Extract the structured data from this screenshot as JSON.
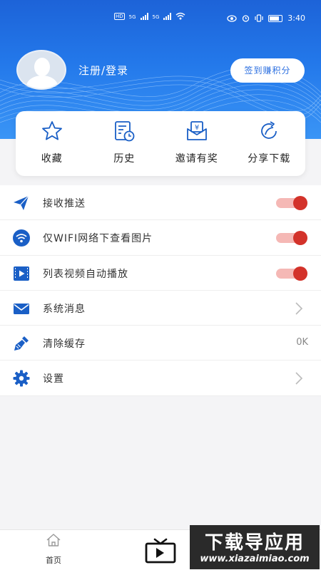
{
  "status_bar": {
    "time": "3:40",
    "left_badges": [
      "HD",
      "HD"
    ],
    "network_labels": [
      "5G",
      "5G"
    ],
    "battery_level": 0.7
  },
  "profile": {
    "login_label": "注册/登录",
    "checkin_button": "签到赚积分"
  },
  "quick_actions": [
    {
      "label": "收藏",
      "icon": "star-icon"
    },
    {
      "label": "历史",
      "icon": "history-icon"
    },
    {
      "label": "邀请有奖",
      "icon": "invite-reward-icon"
    },
    {
      "label": "分享下载",
      "icon": "share-icon"
    }
  ],
  "settings": [
    {
      "label": "接收推送",
      "icon": "send-icon",
      "control": "toggle",
      "on": true
    },
    {
      "label": "仅WIFI网络下查看图片",
      "icon": "wifi-icon",
      "control": "toggle",
      "on": true
    },
    {
      "label": "列表视频自动播放",
      "icon": "video-play-icon",
      "control": "toggle",
      "on": true
    },
    {
      "label": "系统消息",
      "icon": "mail-icon",
      "control": "chevron"
    },
    {
      "label": "清除缓存",
      "icon": "broom-icon",
      "control": "value",
      "value": "0K"
    },
    {
      "label": "设置",
      "icon": "gear-icon",
      "control": "chevron"
    }
  ],
  "tabbar": {
    "home_label": "首页"
  },
  "watermark": {
    "title": "下载导应用",
    "url": "www.xiazaimiao.com"
  },
  "colors": {
    "brand_blue": "#1d63d8",
    "toggle_on": "#d3322a",
    "icon_blue": "#1a5fc6"
  }
}
